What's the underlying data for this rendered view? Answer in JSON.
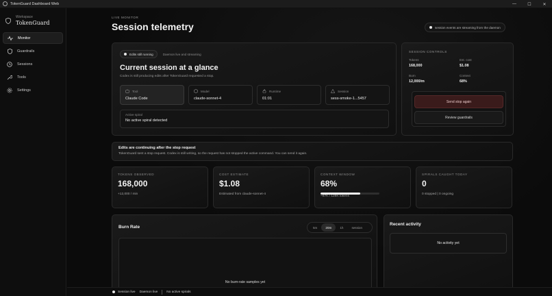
{
  "window": {
    "title": "TokenGuard Dashboard Web",
    "minimize": "—",
    "maximize": "☐",
    "close": "✕"
  },
  "sidebar": {
    "workspace_label": "Workspace",
    "brand": "TokenGuard",
    "items": [
      {
        "label": "Monitor",
        "icon": "pulse-icon",
        "active": true
      },
      {
        "label": "Guardrails",
        "icon": "shield-icon",
        "active": false
      },
      {
        "label": "Sessions",
        "icon": "clock-icon",
        "active": false
      },
      {
        "label": "Tools",
        "icon": "wrench-icon",
        "active": false
      },
      {
        "label": "Settings",
        "icon": "gear-icon",
        "active": false
      }
    ]
  },
  "header": {
    "eyebrow": "LIVE MONITOR",
    "title": "Session telemetry",
    "stream_pill": "session events are streaming from the daemon"
  },
  "hero": {
    "chip_running": "Edits still running",
    "chip_daemon": "Daemon live and streaming",
    "title": "Current session at a glance",
    "subtitle": "Codex is still producing edits after TokenGuard requested a stop.",
    "tiles": [
      {
        "label": "Tool",
        "value": "Claude Code"
      },
      {
        "label": "Model",
        "value": "claude-sonnet-4"
      },
      {
        "label": "Runtime",
        "value": "01:01"
      },
      {
        "label": "Session",
        "value": "sess-smoke-1...5457"
      }
    ],
    "spiral_label": "Active spiral",
    "spiral_value": "No active spiral detected"
  },
  "controls": {
    "heading": "SESSION CONTROLS",
    "tokens_label": "Tokens",
    "tokens_value": "168,000",
    "cost_label": "Est. cost",
    "cost_value": "$1.08",
    "burn_label": "Burn",
    "burn_value": "12,000/m",
    "context_label": "Context",
    "context_value": "68%",
    "stop_button": "Send stop again",
    "review_button": "Review guardrails"
  },
  "notice": {
    "title": "Edits are continuing after the stop request",
    "body": "TokenGuard sent a stop request. Codex is still writing, so the request has not stopped the active command. You can send it again."
  },
  "metrics": {
    "tokens": {
      "label": "TOKENS OBSERVED",
      "value": "168,000",
      "sub": "+12,000 / min"
    },
    "cost": {
      "label": "COST ESTIMATE",
      "value": "$1.08",
      "sub": "Estimated from claude-sonnet-4"
    },
    "context": {
      "label": "CONTEXT WINDOW",
      "value": "68%",
      "sub": "~87K / 128K tokens",
      "fill_fraction": 0.68
    },
    "spirals": {
      "label": "SPIRALS CAUGHT TODAY",
      "value": "0",
      "sub": "0 stopped | 0 ongoing"
    }
  },
  "burn": {
    "title": "Burn Rate",
    "ranges": [
      "5m",
      "20m",
      "1h",
      "session"
    ],
    "active_range": "20m",
    "empty": "No burn-rate samples yet"
  },
  "activity": {
    "title": "Recent activity",
    "empty": "No activity yet"
  },
  "statusbar": {
    "session": "Session live",
    "daemon": "Daemon live",
    "spirals": "No active spirals"
  }
}
